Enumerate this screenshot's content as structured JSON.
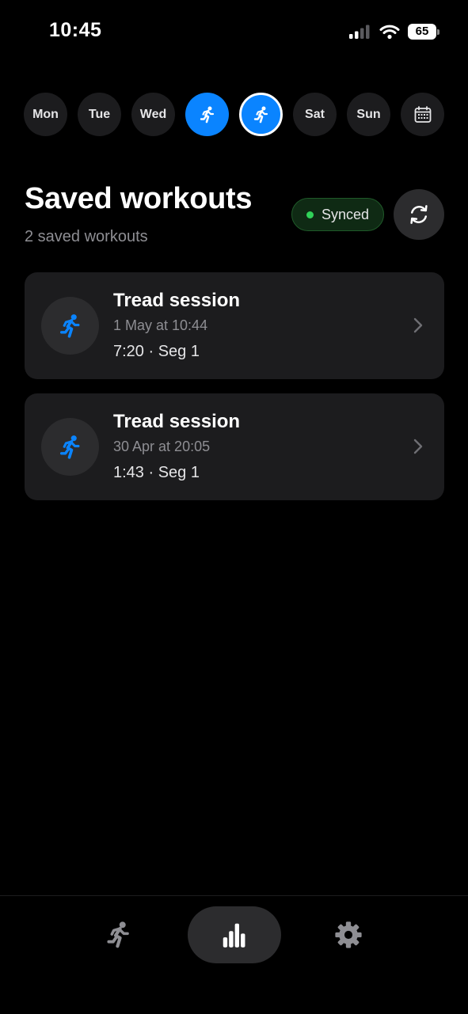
{
  "status_bar": {
    "time": "10:45",
    "battery": "65"
  },
  "week": {
    "days": [
      {
        "label": "Mon",
        "state": "default"
      },
      {
        "label": "Tue",
        "state": "default"
      },
      {
        "label": "Wed",
        "state": "default"
      },
      {
        "label": "",
        "icon": "run-icon",
        "state": "workout-logged"
      },
      {
        "label": "",
        "icon": "run-icon",
        "state": "selected-today"
      },
      {
        "label": "Sat",
        "state": "default"
      },
      {
        "label": "Sun",
        "state": "default"
      }
    ],
    "calendar_icon": "calendar-icon"
  },
  "header": {
    "title": "Saved workouts",
    "subtitle": "2 saved workouts",
    "sync_status": "Synced",
    "refresh_icon": "refresh-icon"
  },
  "workouts": [
    {
      "title": "Tread session",
      "date": "1 May at 10:44",
      "meta": "7:20 · Seg 1",
      "icon": "run-icon"
    },
    {
      "title": "Tread session",
      "date": "30 Apr at 20:05",
      "meta": "1:43 · Seg 1",
      "icon": "run-icon"
    }
  ],
  "tab_bar": {
    "tabs": [
      {
        "name": "run",
        "icon": "run-icon",
        "active": false
      },
      {
        "name": "stats",
        "icon": "bar-chart-icon",
        "active": true
      },
      {
        "name": "settings",
        "icon": "gear-icon",
        "active": false
      }
    ]
  },
  "colors": {
    "accent": "#0a84ff",
    "background": "#000000",
    "card": "#1c1c1e",
    "synced_dot": "#30d158",
    "muted_text": "#8e8e93"
  }
}
